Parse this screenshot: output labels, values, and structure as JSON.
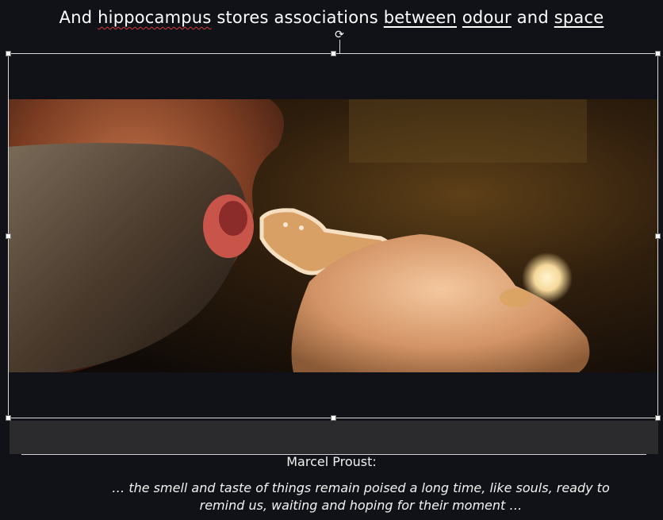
{
  "slide": {
    "title_parts": [
      "And ",
      "hippocampus",
      " stores associations ",
      "between",
      " ",
      "odour",
      " and ",
      "space"
    ],
    "author": "Marcel Proust:",
    "quote_line1": "… the smell and taste of things remain poised a long time, like souls, ready to",
    "quote_line2": "remind us, waiting and hoping for their moment …"
  },
  "colors": {
    "background": "#111217",
    "caption_bar": "#2b2b2e",
    "spellcheck_underline": "#d23b3b",
    "selection_border": "#d9d9d9"
  },
  "icons": {
    "rotate": "rotate-icon"
  }
}
